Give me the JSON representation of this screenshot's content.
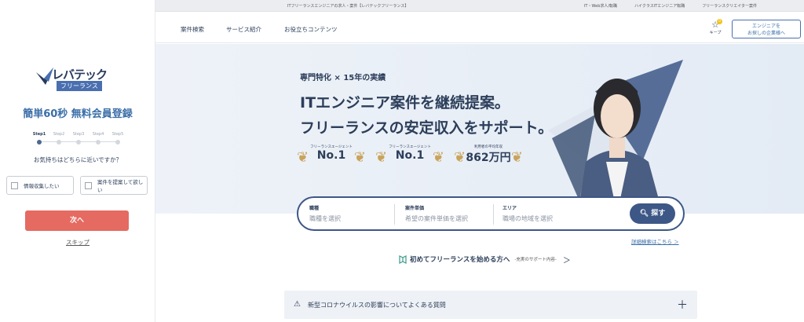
{
  "left": {
    "logo_text": "レバテック",
    "logo_sub": "フリーランス",
    "title": "簡単60秒 無料会員登録",
    "steps": [
      "Step1",
      "Step2",
      "Step3",
      "Step4",
      "Step5"
    ],
    "question": "お気持ちはどちらに近いですか？",
    "options": [
      "情報収集したい",
      "案件を提案して欲しい"
    ],
    "next_label": "次へ",
    "skip_label": "スキップ"
  },
  "topbar": {
    "center_text": "ITフリーランスエンジニアの求人・案件【レバテックフリーランス】",
    "links": [
      "IT・Web求人/転職",
      "ハイクラスITエンジニア転職",
      "フリーランスクリエイター案件"
    ]
  },
  "nav": {
    "items": [
      "案件検索",
      "サービス紹介",
      "お役立ちコンテンツ"
    ],
    "keep_label": "キープ",
    "keep_count": "0",
    "corp_button_line1": "エンジニアを",
    "corp_button_line2": "お探しの企業様へ"
  },
  "hero": {
    "tag": "専門特化 × 15年の実績",
    "headline1": "ITエンジニア案件を継続提案。",
    "headline2": "フリーランスの安定収入をサポート。",
    "awards": [
      {
        "caption": "フリーランスエージェント",
        "value": "No.1"
      },
      {
        "caption": "フリーランスエージェント",
        "value": "No.1"
      },
      {
        "caption": "利用者の平均年収",
        "value": "862万円"
      }
    ]
  },
  "search": {
    "fields": [
      {
        "label": "職種",
        "placeholder": "職種を選択"
      },
      {
        "label": "案件単価",
        "placeholder": "希望の案件単価を選択"
      },
      {
        "label": "エリア",
        "placeholder": "職場の地域を選択"
      }
    ],
    "button_label": "探す",
    "advanced_label": "詳細検索はこちら ＞"
  },
  "first_time": {
    "title": "初めてフリーランスを始める方へ",
    "subtitle": "-充実のサポート内容-",
    "chevron": "＞"
  },
  "faq": {
    "title": "新型コロナウイルスの影響についてよくある質問",
    "warning_icon": "⚠",
    "plus": "＋"
  },
  "colors": {
    "accent_blue": "#3d5787",
    "cta_red": "#e56a61",
    "title_blue": "#3a6ea8",
    "gold": "#c9a35a"
  }
}
